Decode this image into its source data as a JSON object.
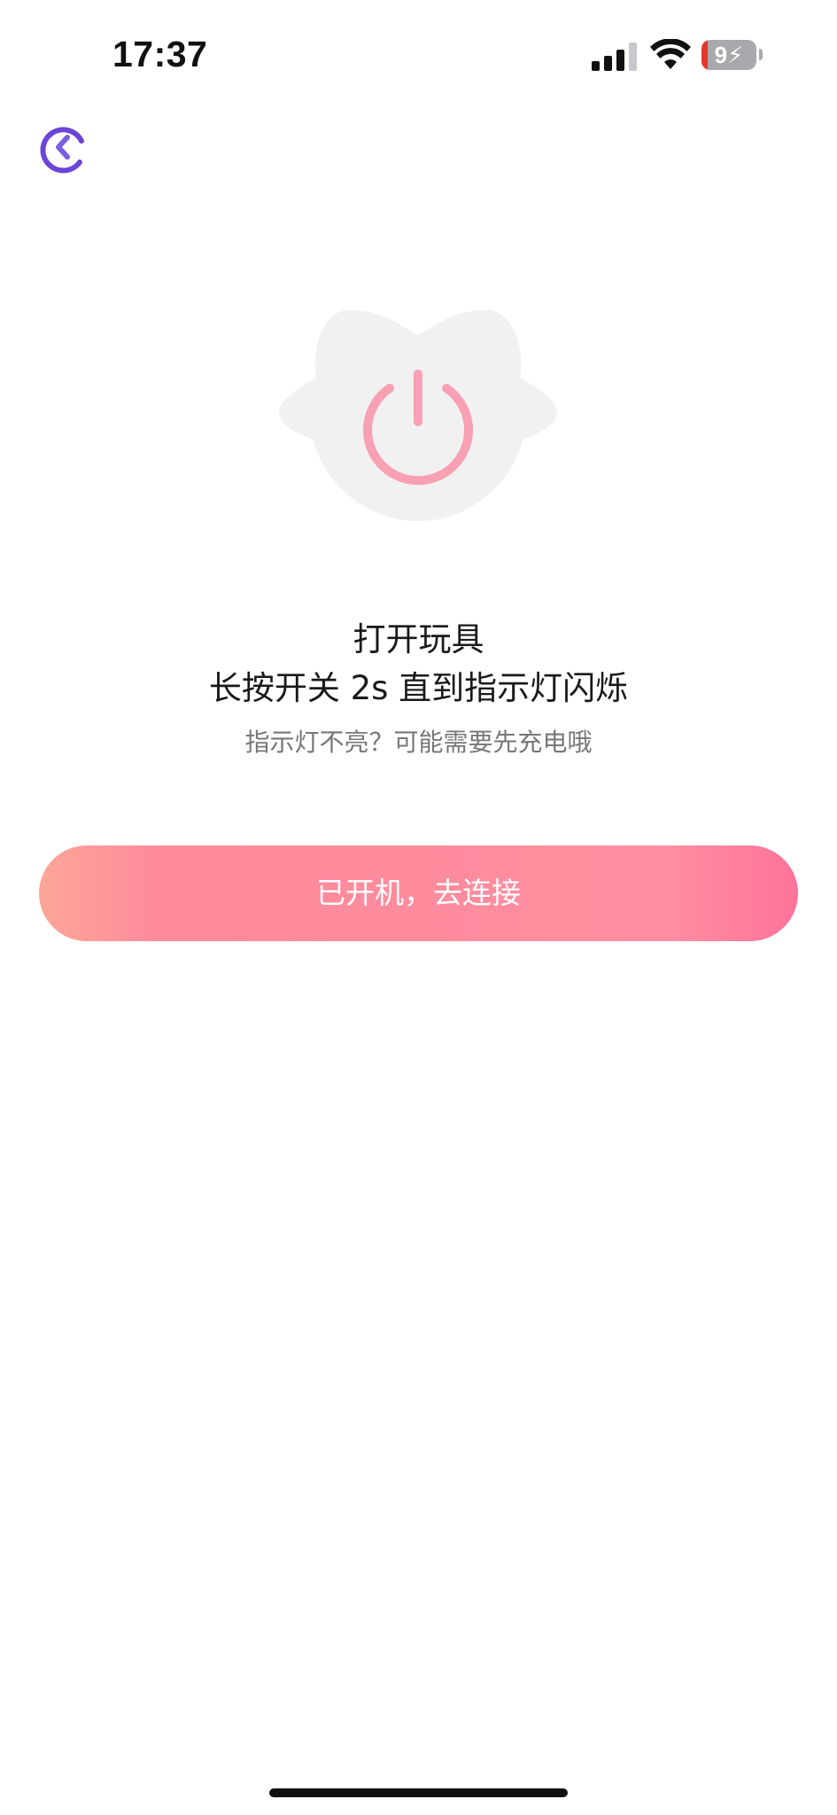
{
  "status_bar": {
    "time": "17:37",
    "battery_level": "9",
    "battery_charging": true,
    "signal_icon": "cellular-signal-icon",
    "wifi_icon": "wifi-icon",
    "battery_icon": "battery-icon"
  },
  "nav": {
    "back_icon": "back-chevron-icon"
  },
  "illustration": {
    "icon": "power-icon"
  },
  "instructions": {
    "title": "打开玩具",
    "subtitle": "长按开关 2s 直到指示灯闪烁",
    "hint": "指示灯不亮？可能需要先充电哦"
  },
  "actions": {
    "connect_label": "已开机，去连接"
  },
  "colors": {
    "accent_purple": "#6b45d8",
    "button_gradient_start": "#fda698",
    "button_gradient_mid": "#ff8c9d",
    "button_gradient_end": "#ff739a",
    "power_icon": "#f8a0b4",
    "illustration_bg": "#f2f1f2"
  }
}
